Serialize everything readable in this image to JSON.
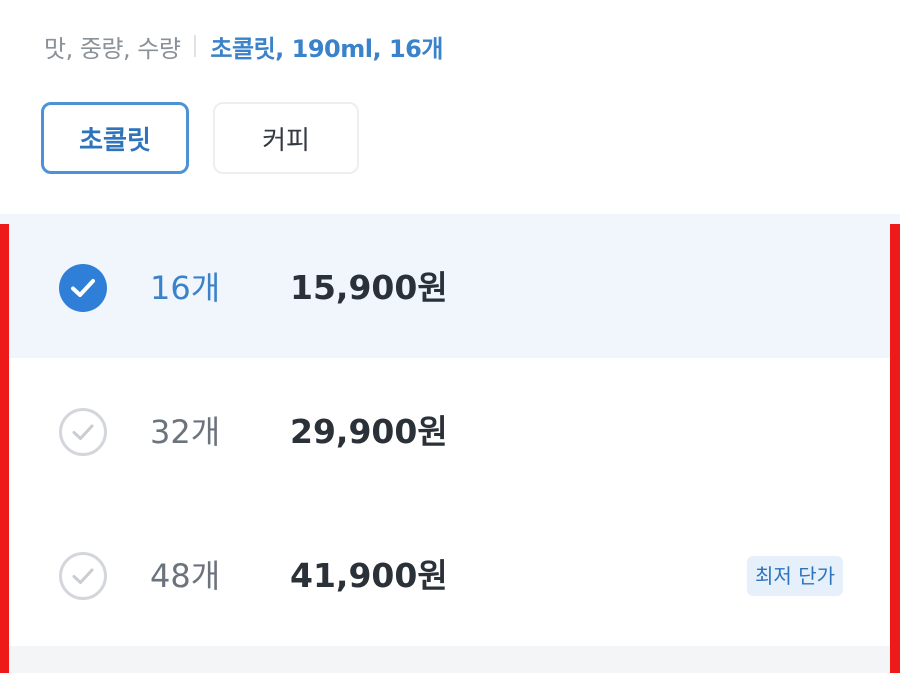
{
  "summary": {
    "label": "맛, 중량, 수량",
    "value": "초콜릿, 190ml, 16개"
  },
  "flavors": [
    {
      "label": "초콜릿",
      "selected": true
    },
    {
      "label": "커피",
      "selected": false
    }
  ],
  "options": [
    {
      "quantity": "16개",
      "price": "15,900원",
      "selected": true
    },
    {
      "quantity": "32개",
      "price": "29,900원",
      "selected": false
    },
    {
      "quantity": "48개",
      "price": "41,900원",
      "selected": false,
      "badge": "최저 단가"
    }
  ],
  "colors": {
    "accent": "#2f7fd8",
    "selected_row_bg": "#f1f6fd",
    "highlight_bar": "#ee1a1a"
  },
  "icons": {
    "selected": "check-circle-filled-icon",
    "unselected": "check-circle-outline-icon"
  }
}
